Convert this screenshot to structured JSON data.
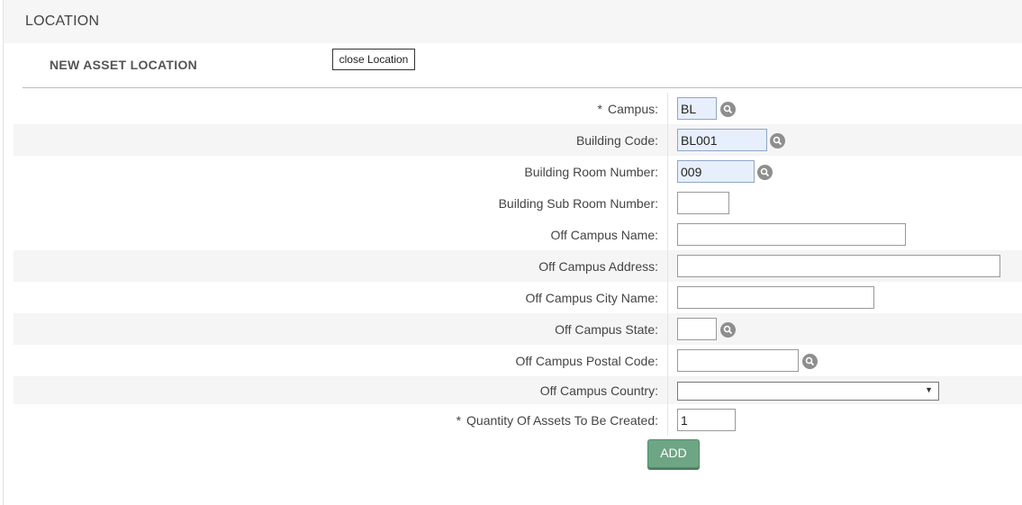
{
  "header": {
    "title": "LOCATION"
  },
  "section": {
    "title": "NEW ASSET LOCATION",
    "close_label": "close Location"
  },
  "form": {
    "campus": {
      "label": "Campus:",
      "required_mark": "*",
      "value": "BL"
    },
    "building_code": {
      "label": "Building Code:",
      "value": "BL001"
    },
    "building_room_number": {
      "label": "Building Room Number:",
      "value": "009"
    },
    "building_sub_room_number": {
      "label": "Building Sub Room Number:",
      "value": ""
    },
    "off_campus_name": {
      "label": "Off Campus Name:",
      "value": ""
    },
    "off_campus_address": {
      "label": "Off Campus Address:",
      "value": ""
    },
    "off_campus_city_name": {
      "label": "Off Campus City Name:",
      "value": ""
    },
    "off_campus_state": {
      "label": "Off Campus State:",
      "value": ""
    },
    "off_campus_postal_code": {
      "label": "Off Campus Postal Code:",
      "value": ""
    },
    "off_campus_country": {
      "label": "Off Campus Country:",
      "selected": ""
    },
    "quantity": {
      "label": "Quantity Of Assets To Be Created:",
      "required_mark": "*",
      "value": "1"
    }
  },
  "actions": {
    "add_label": "ADD"
  },
  "icons": {
    "lookup": "search-icon",
    "dropdown": "chevron-down-icon"
  },
  "colors": {
    "add_button": "#6ea584",
    "filled_field": "#e8effc",
    "lookup_icon": "#8e8e8e"
  }
}
